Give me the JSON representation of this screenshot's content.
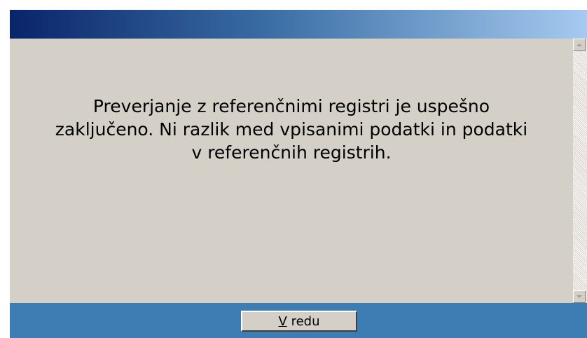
{
  "dialog": {
    "message": "Preverjanje z referenčnimi registri je uspešno\nzaključeno. Ni razlik med vpisanimi podatki in podatki\nv referenčnih registrih.",
    "ok_button": {
      "mnemonic": "V",
      "rest": " redu"
    }
  },
  "icons": {
    "scroll_up": "scroll-up-arrow-icon",
    "scroll_down": "scroll-down-arrow-icon"
  },
  "colors": {
    "titlebar_start": "#0a246a",
    "titlebar_end": "#a6caf0",
    "content_bg": "#d4d0c8",
    "footer_bg": "#3e7db3"
  }
}
